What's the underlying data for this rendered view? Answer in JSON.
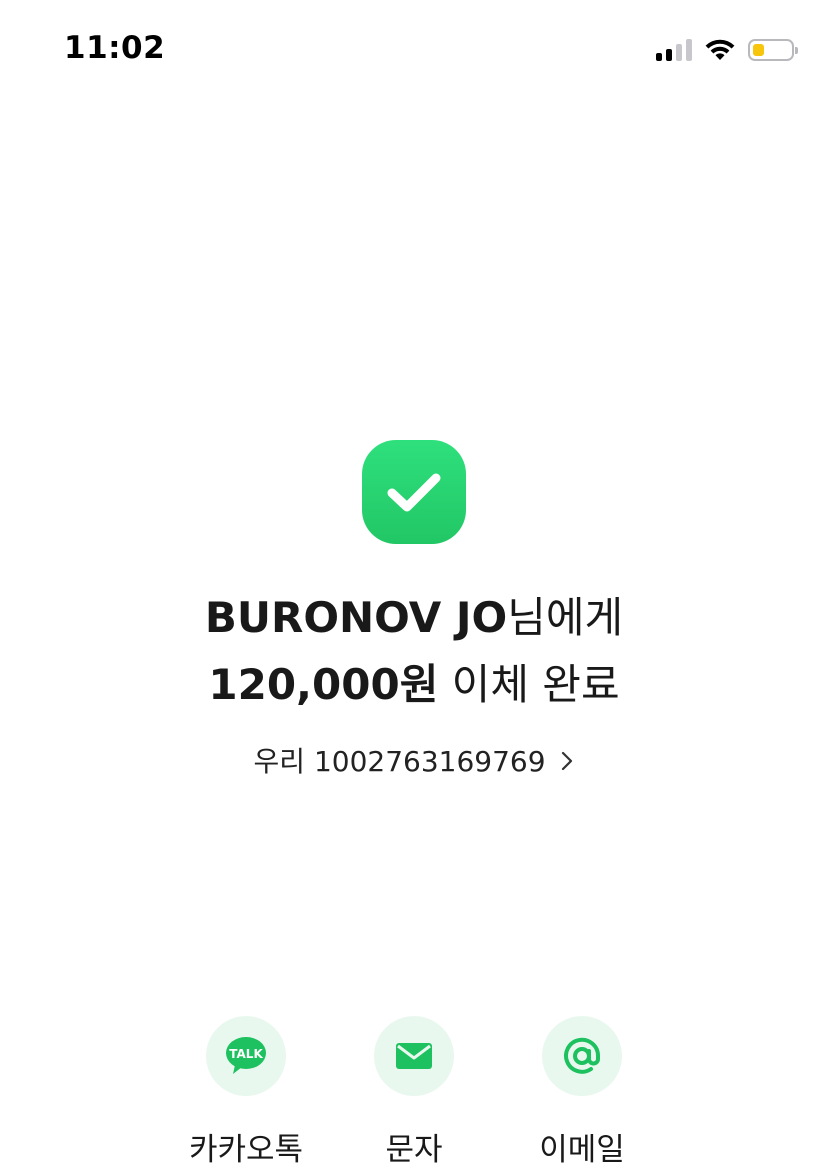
{
  "status_bar": {
    "time": "11:02",
    "icons": [
      "cellular-signal-icon",
      "wifi-icon",
      "battery-icon"
    ],
    "battery_level": 0.3,
    "battery_color": "#f7c60c"
  },
  "result": {
    "icon": "check-icon",
    "icon_color": "#27d46f",
    "recipient": "BURONOV JO",
    "recipient_suffix": "님에게",
    "amount": "120,000원",
    "status": " 이체 완료",
    "account": "우리 1002763169769",
    "account_chevron": "chevron-right-icon"
  },
  "share": {
    "accent": "#1ec15f",
    "items": [
      {
        "label": "카카오톡",
        "icon": "kakaotalk-icon",
        "icon_text": "TALK"
      },
      {
        "label": "문자",
        "icon": "message-icon"
      },
      {
        "label": "이메일",
        "icon": "email-at-icon"
      }
    ]
  }
}
